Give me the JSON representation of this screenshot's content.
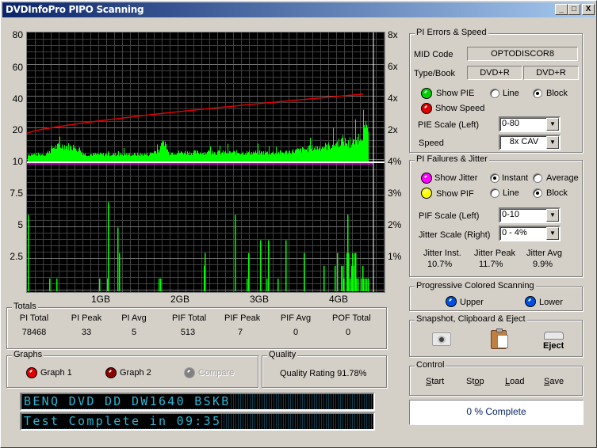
{
  "window": {
    "title": "DVDInfoPro PIPO Scanning",
    "buttons": {
      "minimize": "_",
      "maximize": "□",
      "close": "X"
    }
  },
  "chart_data": [
    {
      "type": "bar",
      "title": "PI Errors & Speed",
      "y_left_ticks": [
        "80",
        "60",
        "40",
        "20",
        "10"
      ],
      "y_left_range": [
        0,
        80
      ],
      "y_right_ticks": [
        "8x",
        "6x",
        "4x",
        "2x",
        "4%"
      ],
      "y_right_range": [
        0,
        8
      ],
      "x_range_gb": [
        0,
        4.7
      ],
      "end_gb": 4.38,
      "pie_profile": [
        {
          "gb": 0.0,
          "v": 4
        },
        {
          "gb": 0.3,
          "v": 4
        },
        {
          "gb": 0.4,
          "v": 8
        },
        {
          "gb": 0.55,
          "v": 9
        },
        {
          "gb": 0.7,
          "v": 7
        },
        {
          "gb": 0.8,
          "v": 4
        },
        {
          "gb": 1.6,
          "v": 4
        },
        {
          "gb": 1.75,
          "v": 7
        },
        {
          "gb": 1.8,
          "v": 12
        },
        {
          "gb": 1.85,
          "v": 5
        },
        {
          "gb": 3.3,
          "v": 5
        },
        {
          "gb": 3.6,
          "v": 7
        },
        {
          "gb": 3.9,
          "v": 9
        },
        {
          "gb": 4.05,
          "v": 12
        },
        {
          "gb": 4.15,
          "v": 9
        },
        {
          "gb": 4.3,
          "v": 16
        },
        {
          "gb": 4.38,
          "v": 20
        }
      ],
      "speed_series": {
        "name": "Speed",
        "start_x": 1.75,
        "end_x": 4.2,
        "unit": "x"
      },
      "series": [
        {
          "name": "PIE",
          "color": "#00ff00"
        },
        {
          "name": "Speed",
          "color": "#ff0000"
        }
      ]
    },
    {
      "type": "bar",
      "title": "PI Failures & Jitter",
      "y_left_ticks": [
        "7.5",
        "5",
        "2.5"
      ],
      "y_left_range": [
        0,
        10
      ],
      "y_right_ticks": [
        "3%",
        "2%",
        "1%"
      ],
      "x_ticks": [
        "1GB",
        "2GB",
        "3GB",
        "4GB"
      ],
      "pif_spikes": [
        {
          "gb": 0.08,
          "v": 6
        },
        {
          "gb": 0.35,
          "v": 1
        },
        {
          "gb": 0.44,
          "v": 1
        },
        {
          "gb": 0.98,
          "v": 1
        },
        {
          "gb": 1.08,
          "v": 1
        },
        {
          "gb": 1.09,
          "v": 7
        },
        {
          "gb": 1.21,
          "v": 5
        },
        {
          "gb": 1.23,
          "v": 3
        },
        {
          "gb": 1.73,
          "v": 1
        },
        {
          "gb": 1.75,
          "v": 1
        },
        {
          "gb": 2.3,
          "v": 2
        },
        {
          "gb": 2.31,
          "v": 3
        },
        {
          "gb": 2.69,
          "v": 6
        },
        {
          "gb": 2.84,
          "v": 1
        },
        {
          "gb": 2.86,
          "v": 3
        },
        {
          "gb": 3.01,
          "v": 4
        },
        {
          "gb": 3.09,
          "v": 1
        },
        {
          "gb": 3.11,
          "v": 4
        },
        {
          "gb": 3.23,
          "v": 1
        },
        {
          "gb": 3.33,
          "v": 4
        },
        {
          "gb": 3.56,
          "v": 3
        },
        {
          "gb": 3.81,
          "v": 2
        },
        {
          "gb": 3.95,
          "v": 2
        },
        {
          "gb": 3.98,
          "v": 3
        },
        {
          "gb": 4.03,
          "v": 2
        },
        {
          "gb": 4.05,
          "v": 2
        },
        {
          "gb": 4.06,
          "v": 1
        },
        {
          "gb": 4.1,
          "v": 3
        },
        {
          "gb": 4.11,
          "v": 6
        },
        {
          "gb": 4.12,
          "v": 3
        },
        {
          "gb": 4.14,
          "v": 1
        },
        {
          "gb": 4.16,
          "v": 2
        },
        {
          "gb": 4.17,
          "v": 3
        },
        {
          "gb": 4.18,
          "v": 2
        },
        {
          "gb": 4.2,
          "v": 3
        },
        {
          "gb": 4.21,
          "v": 3
        },
        {
          "gb": 4.22,
          "v": 1
        },
        {
          "gb": 4.24,
          "v": 1
        },
        {
          "gb": 4.28,
          "v": 1
        },
        {
          "gb": 4.3,
          "v": 2
        },
        {
          "gb": 4.31,
          "v": 1
        },
        {
          "gb": 4.33,
          "v": 1
        },
        {
          "gb": 4.35,
          "v": 1
        },
        {
          "gb": 4.37,
          "v": 1
        }
      ],
      "series": [
        {
          "name": "PIF",
          "color": "#00ff00"
        },
        {
          "name": "Jitter",
          "color": "#ff00ff"
        }
      ]
    }
  ],
  "pi_errors": {
    "title": "PI Errors & Speed",
    "mid_label": "MID Code",
    "mid_value": "OPTODISCOR8",
    "type_label": "Type/Book",
    "type_value": "DVD+R",
    "book_value": "DVD+R",
    "show_pie": "Show PIE",
    "line": "Line",
    "block": "Block",
    "show_speed": "Show Speed",
    "pie_scale_label": "PIE Scale (Left)",
    "pie_scale_value": "0-80",
    "speed_label": "Speed",
    "speed_value": "8x CAV"
  },
  "pi_failures": {
    "title": "PI Failures & Jitter",
    "show_jitter": "Show Jitter",
    "instant": "Instant",
    "average": "Average",
    "show_pif": "Show PIF",
    "line": "Line",
    "block": "Block",
    "pif_scale_label": "PIF Scale (Left)",
    "pif_scale_value": "0-10",
    "jitter_scale_label": "Jitter Scale (Right)",
    "jitter_scale_value": "0 - 4%",
    "jitter_inst_label": "Jitter Inst.",
    "jitter_inst_value": "10.7%",
    "jitter_peak_label": "Jitter Peak",
    "jitter_peak_value": "11.7%",
    "jitter_avg_label": "Jitter Avg",
    "jitter_avg_value": "9.9%"
  },
  "progressive": {
    "title": "Progressive Colored Scanning",
    "upper": "Upper",
    "lower": "Lower"
  },
  "snapshot": {
    "title": "Snapshot,  Clipboard  & Eject",
    "eject": "Eject"
  },
  "control": {
    "title": "Control",
    "start": "Start",
    "stop": "Stop",
    "load": "Load",
    "save": "Save"
  },
  "progress": {
    "text": "0 % Complete",
    "value_percent": 0
  },
  "totals": {
    "title": "Totals",
    "headers": [
      "PI Total",
      "PI Peak",
      "PI Avg",
      "PIF Total",
      "PIF Peak",
      "PIF Avg",
      "POF Total"
    ],
    "values": [
      "78468",
      "33",
      "5",
      "513",
      "7",
      "0",
      "0"
    ]
  },
  "graphs": {
    "title": "Graphs",
    "graph1": "Graph 1",
    "graph2": "Graph 2",
    "compare": "Compare"
  },
  "quality": {
    "title": "Quality",
    "rating": "Quality Rating 91.78%"
  },
  "lcd": {
    "line1": "BENQ     DVD DD DW1640 BSKB",
    "line2": "Test Complete in 09:35"
  },
  "colors": {
    "pie": "#00ff00",
    "speed": "#ff0000",
    "jitter": "#ff00ff",
    "pif_led": "#ffff00",
    "lcd_text": "#29b6d6",
    "title_start": "#0a246a",
    "title_end": "#a6caf0"
  }
}
